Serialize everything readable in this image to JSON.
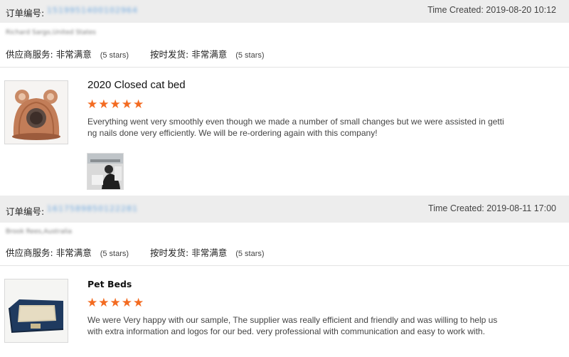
{
  "orders": [
    {
      "order_label": "订单编号:",
      "order_number": "1519951400102964",
      "time_created": "Time Created: 2019-08-20 10:12",
      "buyer": "Richard Sargo,United States",
      "supplier_service": {
        "label": "供应商服务:",
        "value": "非常满意",
        "stars": "(5 stars)"
      },
      "on_time_delivery": {
        "label": "按时发货:",
        "value": "非常满意",
        "stars": "(5 stars)"
      },
      "product": {
        "title": "2020 Closed cat bed",
        "rating_stars": "★★★★★",
        "rating": 5,
        "review": "Everything went very smoothly even though we made a number of small changes but we were assisted in getting nails done very efficiently. We will be re-ordering again with this company!",
        "image_icon": "cat-bed-image",
        "photo_icon": "review-photo"
      }
    },
    {
      "order_label": "订单编号:",
      "order_number": "1617589850122281",
      "time_created": "Time Created: 2019-08-11 17:00",
      "buyer": "Brook Rees,Australia",
      "supplier_service": {
        "label": "供应商服务:",
        "value": "非常满意",
        "stars": "(5 stars)"
      },
      "on_time_delivery": {
        "label": "按时发货:",
        "value": "非常满意",
        "stars": "(5 stars)"
      },
      "product": {
        "title": "Pet Beds",
        "rating_stars": "★★★★★",
        "rating": 5,
        "review": "We were Very happy with our sample, The supplier was really efficient and friendly and was willing to help us with extra information and logos for our bed. very professional with communication and easy to work with.",
        "image_icon": "pet-bed-image"
      }
    }
  ],
  "colors": {
    "star": "#f36b21",
    "header_bg": "#ededed",
    "order_number": "#6aa6df"
  }
}
